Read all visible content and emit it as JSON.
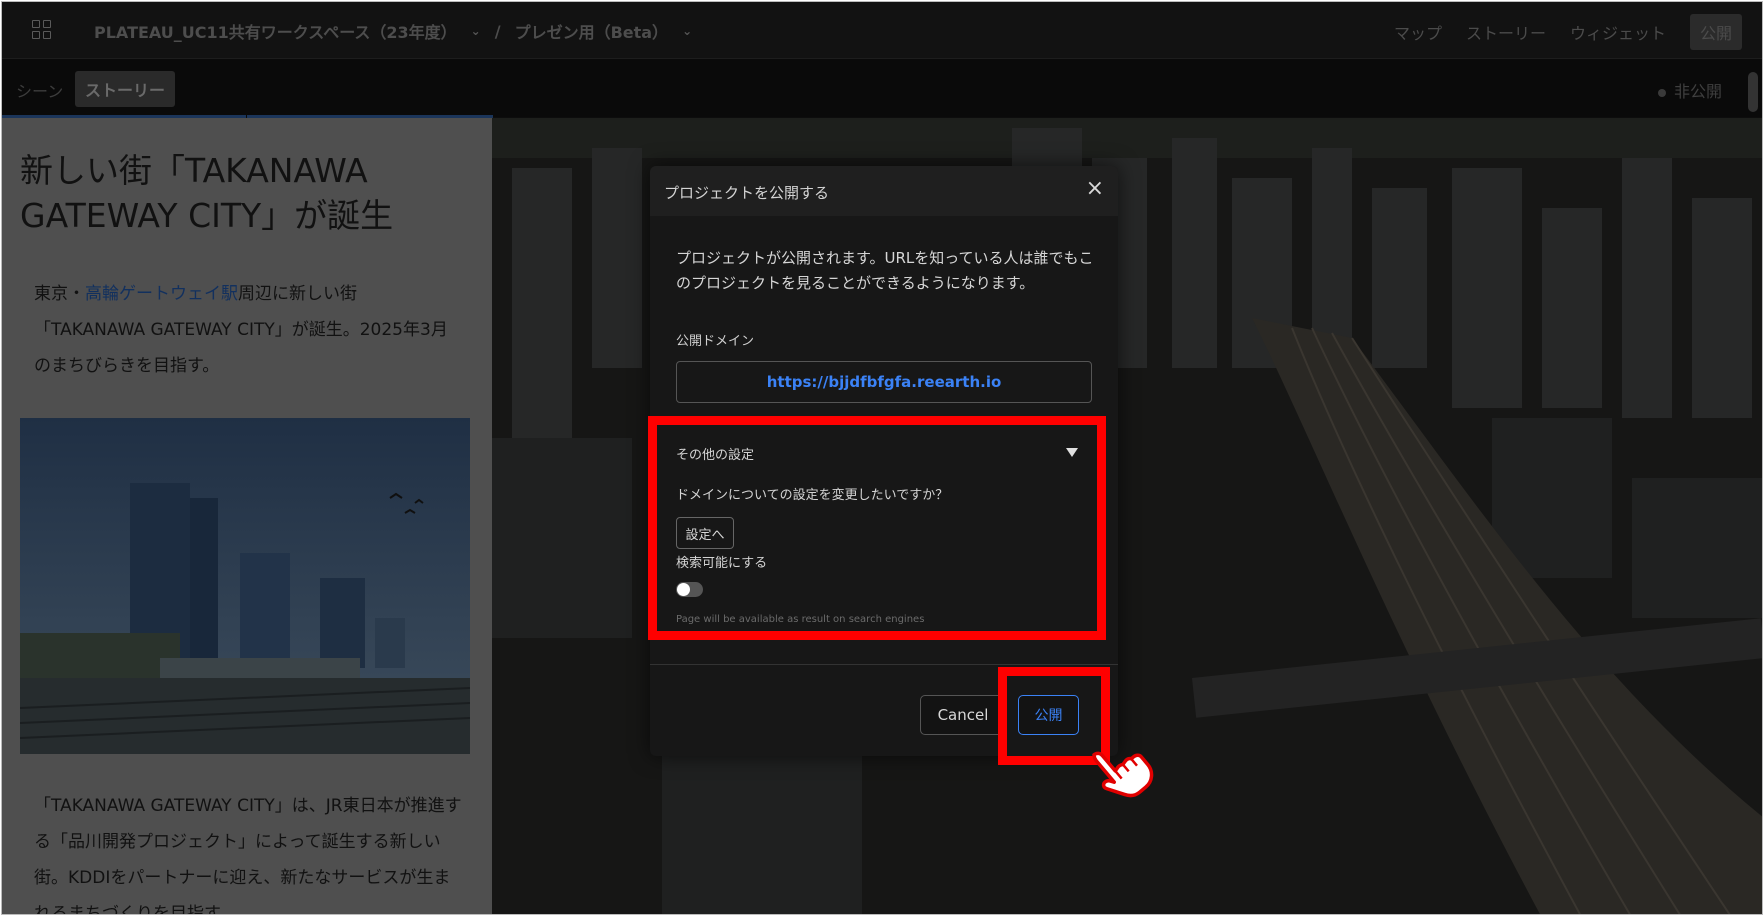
{
  "header": {
    "workspace": "PLATEAU_UC11共有ワークスペース（23年度）",
    "separator": "/",
    "project": "プレゼン用（Beta）",
    "nav": [
      "マップ",
      "ストーリー",
      "ウィジェット"
    ],
    "publish_label": "公開"
  },
  "subbar": {
    "scene_tab": "シーン",
    "story_tab": "ストーリー",
    "status": "非公開"
  },
  "story": {
    "title": "新しい街「TAKANAWA GATEWAY CITY」が誕生",
    "p1_prefix": "東京・",
    "p1_link": "高輪ゲートウェイ駅",
    "p1_suffix": "周辺に新しい街「TAKANAWA GATEWAY CITY」が誕生。2025年3月のまちびらきを目指す。",
    "p2": "「TAKANAWA GATEWAY CITY」は、JR東日本が推進する「品川開発プロジェクト」によって誕生する新しい街。KDDIをパートナーに迎え、新たなサービスが生まれるまちづくりを目指す。"
  },
  "dialog": {
    "title": "プロジェクトを公開する",
    "close": "×",
    "description": "プロジェクトが公開されます。URLを知っている人は誰でもこのプロジェクトを見ることができるようになります。",
    "domain_label": "公開ドメイン",
    "domain_url": "https://bjjdfbfgfa.reearth.io",
    "other_settings": "その他の設定",
    "domain_question": "ドメインについての設定を変更したいですか？",
    "settings_button": "設定へ",
    "searchable_label": "検索可能にする",
    "searchable_on": false,
    "search_hint": "Page will be available as result on search engines",
    "cancel": "Cancel",
    "publish": "公開"
  },
  "colors": {
    "accent": "#3b82f6",
    "annotation": "#ff0000"
  }
}
